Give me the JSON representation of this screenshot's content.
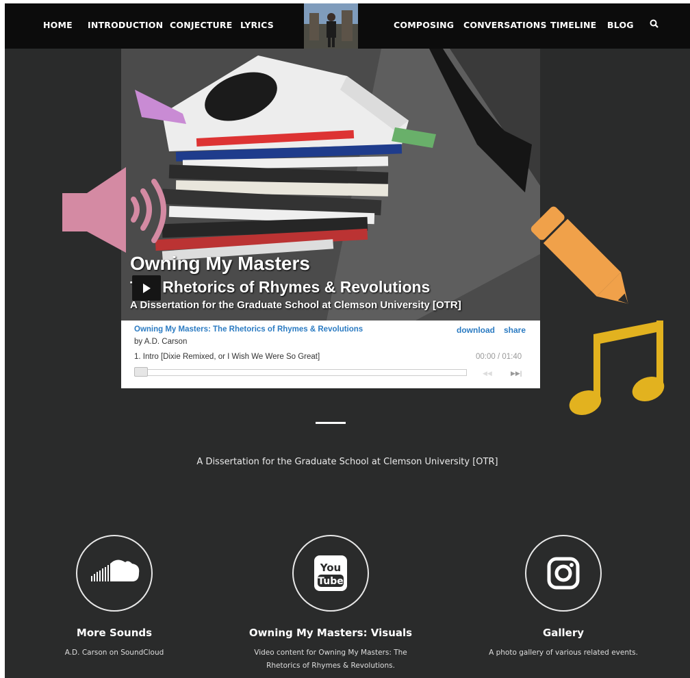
{
  "nav": {
    "items": [
      "HOME",
      "INTRODUCTION",
      "CONJECTURE",
      "LYRICS",
      "COMPOSING",
      "CONVERSATIONS",
      "TIMELINE",
      "BLOG"
    ],
    "search_icon": "search-icon"
  },
  "hero": {
    "title": "Owning My Masters",
    "subtitle": "The Rhetorics of Rhymes & Revolutions",
    "subtitle2": "A Dissertation for the Graduate School at Clemson University [OTR]"
  },
  "player": {
    "album_title": "Owning My Masters: The Rhetorics of Rhymes & Revolutions",
    "artist": "by A.D. Carson",
    "download_label": "download",
    "share_label": "share",
    "track": "1.  Intro [Dixie Remixed, or I Wish We Were So Great]",
    "time": "00:00 / 01:40",
    "progress": 0
  },
  "tagline": "A Dissertation for the Graduate School at Clemson University [OTR]",
  "features": [
    {
      "title": "More Sounds",
      "desc": "A.D. Carson on SoundCloud",
      "icon": "soundcloud-icon"
    },
    {
      "title": "Owning My Masters: Visuals",
      "desc": "Video content for Owning My Masters: The Rhetorics of Rhymes & Revolutions.",
      "icon": "youtube-icon"
    },
    {
      "title": "Gallery",
      "desc": "A photo gallery of various related events.",
      "icon": "instagram-icon"
    }
  ],
  "colors": {
    "background": "#2a2b2b",
    "nav": "#0c0c0c",
    "link": "#2b7bc2",
    "speaker": "#d48aa3",
    "pencil": "#f0a14a",
    "note": "#e2b21f"
  }
}
